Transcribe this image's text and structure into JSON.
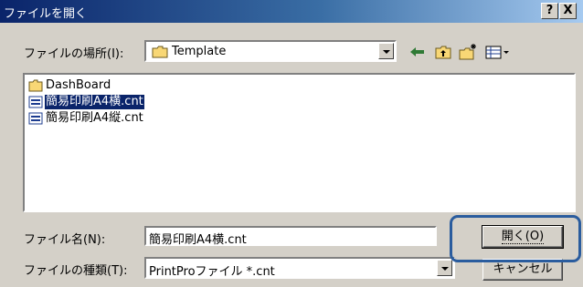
{
  "window": {
    "title": "ファイルを開く",
    "help_label": "?",
    "close_label": "X"
  },
  "lookin": {
    "label": "ファイルの場所(I):",
    "value": "Template"
  },
  "toolbar": {
    "back_icon": "back-arrow-icon",
    "up_icon": "up-folder-icon",
    "new_folder_icon": "new-folder-icon",
    "view_icon": "view-menu-icon"
  },
  "files": [
    {
      "name": "DashBoard",
      "type": "folder",
      "selected": false
    },
    {
      "name": "簡易印刷A4横.cnt",
      "type": "cnt",
      "selected": true
    },
    {
      "name": "簡易印刷A4縦.cnt",
      "type": "cnt",
      "selected": false
    }
  ],
  "filename": {
    "label": "ファイル名(N):",
    "value": "簡易印刷A4横.cnt"
  },
  "filetype": {
    "label": "ファイルの種類(T):",
    "value": "PrintProファイル *.cnt"
  },
  "buttons": {
    "open_label": "開く(O)",
    "cancel_label": "キャンセル"
  },
  "colors": {
    "title_start": "#0a246a",
    "title_end": "#a6caf0",
    "face": "#d4d0c8",
    "selection": "#0a246a",
    "highlight_ring": "#2a5c9e"
  }
}
